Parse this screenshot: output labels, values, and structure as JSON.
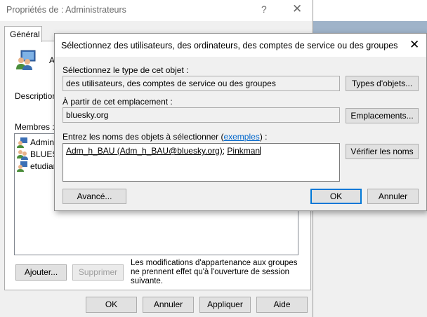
{
  "props_window": {
    "title": "Propriétés de : Administrateurs",
    "help_glyph": "?",
    "close_glyph": "✕",
    "tab_general": "Général",
    "group_name_partial": "A",
    "description_label": "Description",
    "members_label": "Membres :",
    "members": [
      "Administ",
      "BLUES",
      "etudian"
    ],
    "note": "Les modifications d'appartenance aux groupes ne prennent effet qu'à l'ouverture de session suivante.",
    "add_button": "Ajouter...",
    "remove_button": "Supprimer",
    "ok": "OK",
    "cancel": "Annuler",
    "apply": "Appliquer",
    "help": "Aide"
  },
  "dialog": {
    "title": "Sélectionnez des utilisateurs, des ordinateurs, des comptes de service ou des groupes",
    "close_glyph": "✕",
    "type_label": "Sélectionnez le type de cet objet :",
    "type_value": "des utilisateurs, des comptes de service ou des groupes",
    "types_button": "Types d'objets...",
    "location_label": "À partir de cet emplacement :",
    "location_value": "bluesky.org",
    "locations_button": "Emplacements...",
    "names_label_prefix": "Entrez les noms des objets à sélectionner (",
    "names_label_link": "exemples",
    "names_label_suffix": ") :",
    "name_entry_1": "Adm_h_BAU (Adm_h_BAU@bluesky.org)",
    "name_separator": "; ",
    "name_entry_2": "Pinkman",
    "check_names_button": "Vérifier les noms",
    "advanced_button": "Avancé...",
    "ok": "OK",
    "cancel": "Annuler"
  },
  "colors": {
    "accent": "#0078d7",
    "link": "#0066cc",
    "desktop_blue": "#9fb3c9"
  }
}
